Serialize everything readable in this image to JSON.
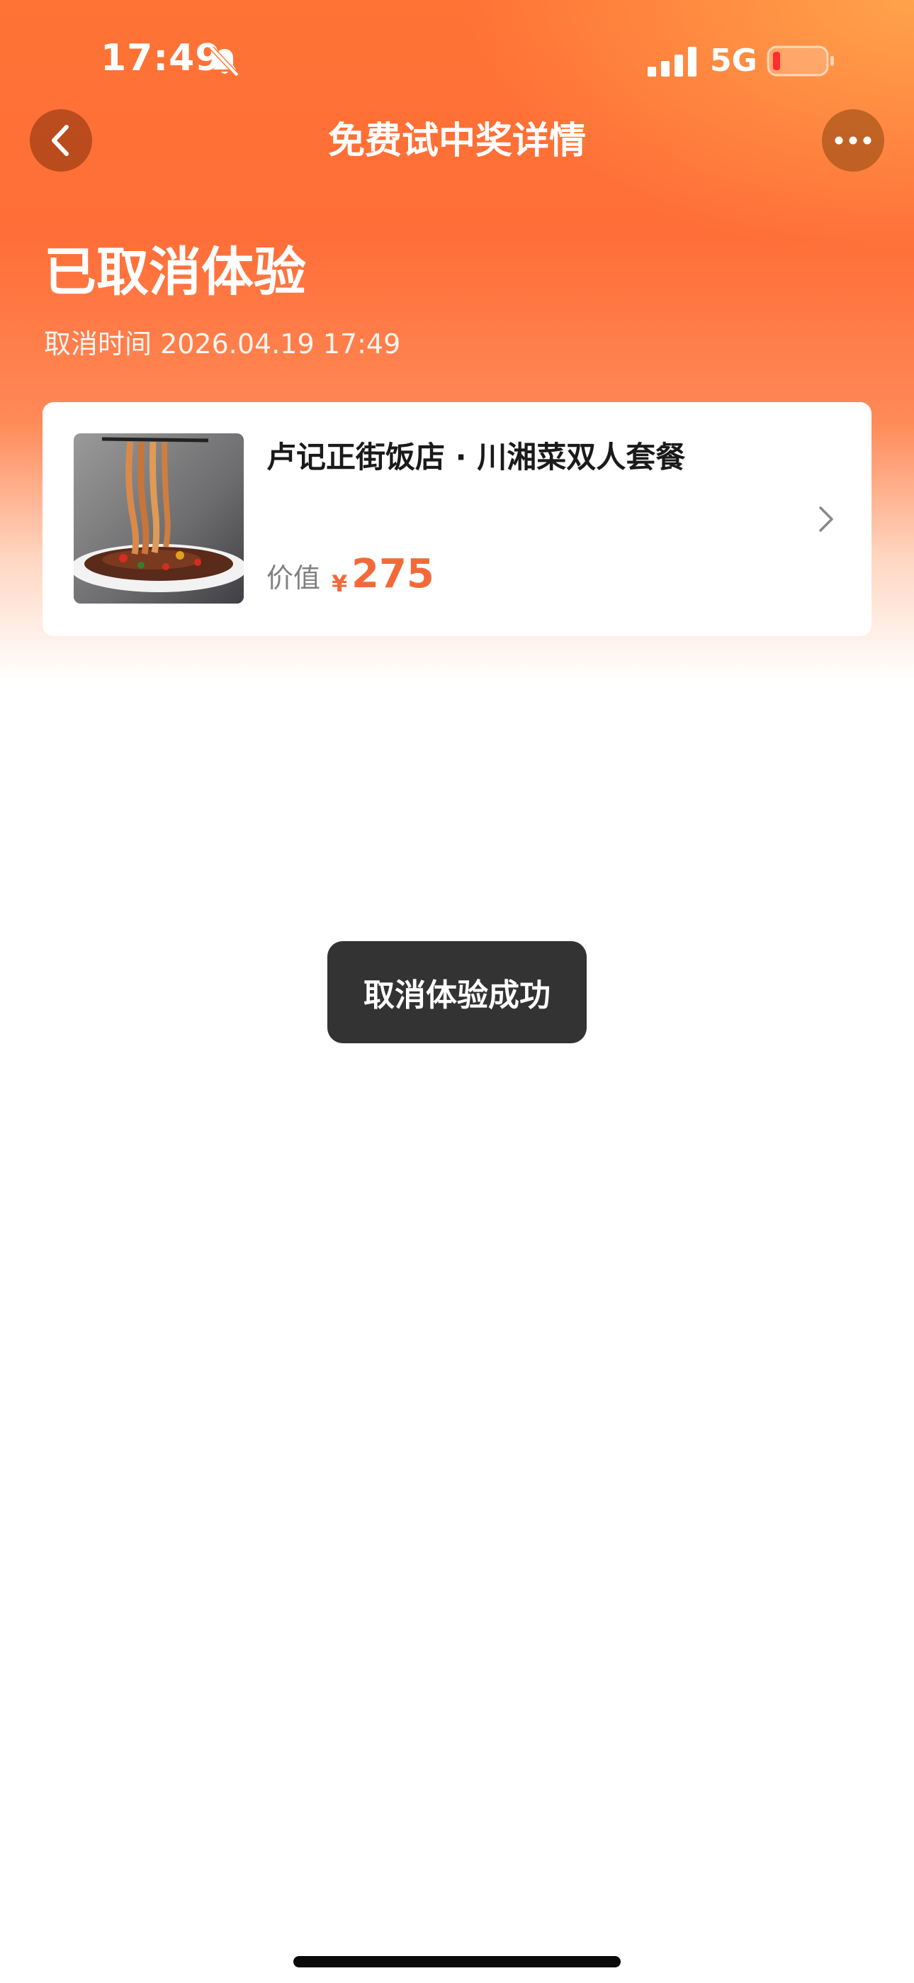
{
  "status_bar": {
    "time": "17:49",
    "network": "5G",
    "icons": [
      "bell-off-icon",
      "signal-icon",
      "battery-icon"
    ]
  },
  "nav": {
    "title": "免费试中奖详情",
    "back_icon": "chevron-left-icon",
    "more_icon": "more-dots-icon"
  },
  "status": {
    "heading": "已取消体验",
    "cancel_time": "取消时间 2026.04.19 17:49"
  },
  "product": {
    "name": "卢记正街饭店 · 川湘菜双人套餐",
    "price_label": "价值",
    "currency": "¥",
    "price": "275",
    "thumbnail": "noodle-dish-image",
    "chevron_icon": "chevron-right-icon"
  },
  "toast": {
    "message": "取消体验成功"
  },
  "colors": {
    "header_orange": "#ff7335",
    "accent_price": "#f26a3a",
    "toast_bg": "#333333",
    "card_bg": "#ffffff"
  }
}
